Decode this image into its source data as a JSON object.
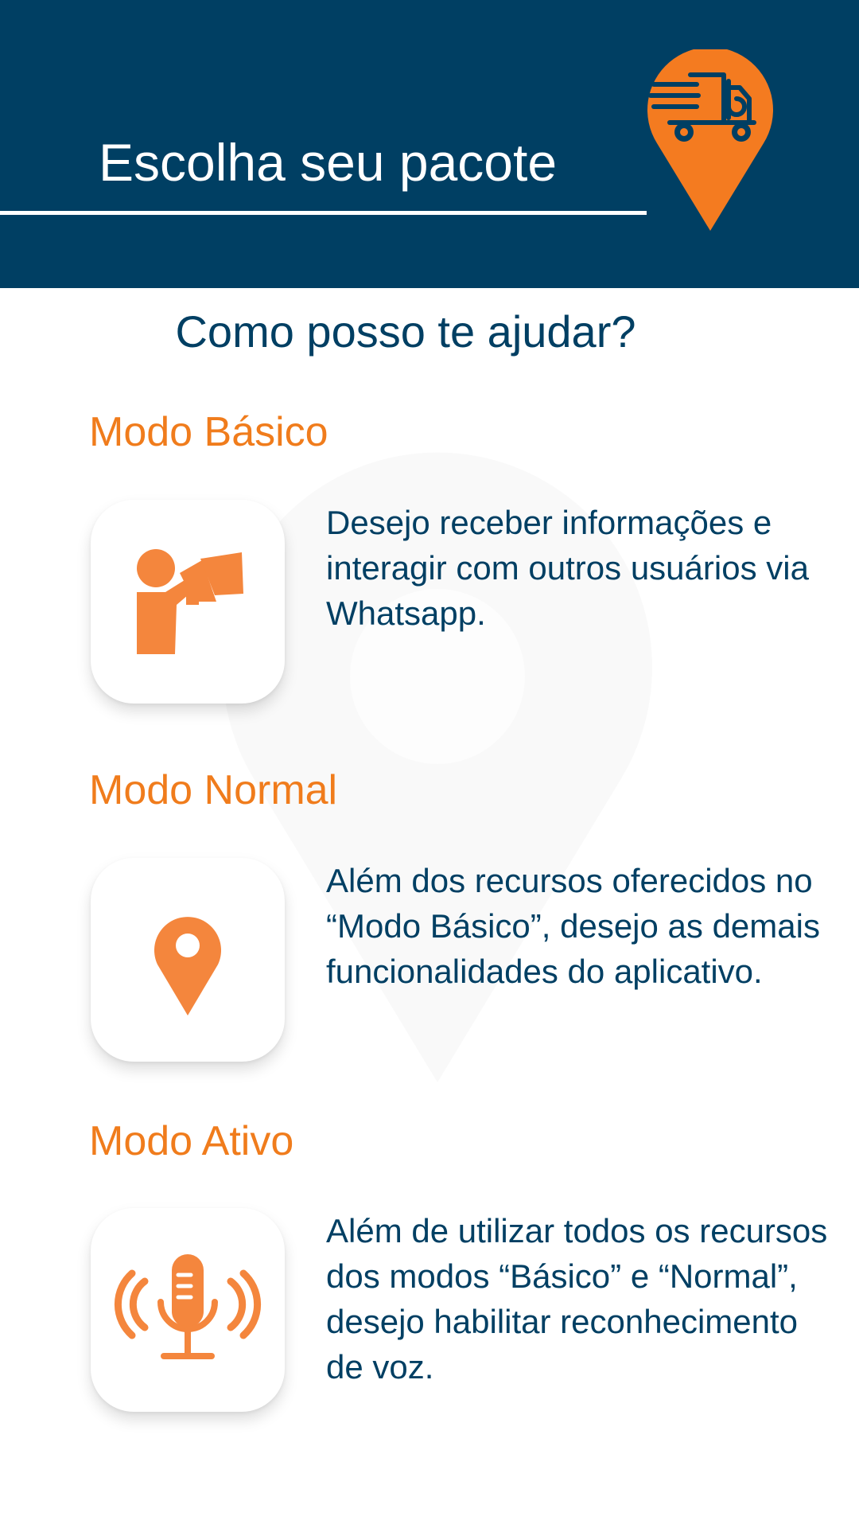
{
  "header": {
    "title": "Escolha seu pacote",
    "logo_icon": "delivery-truck-location-pin-icon"
  },
  "subtitle": "Como posso te ajudar?",
  "modes": [
    {
      "title": "Modo Básico",
      "icon": "megaphone-person-icon",
      "description": "Desejo receber informações e interagir com outros usuários via Whatsapp."
    },
    {
      "title": "Modo Normal",
      "icon": "location-pin-icon",
      "description": "Além dos recursos oferecidos no “Modo Básico”, desejo as demais funcionalidades do aplicativo."
    },
    {
      "title": "Modo Ativo",
      "icon": "microphone-voice-icon",
      "description": "Além de utilizar todos os recursos dos modos “Básico” e “Normal”, desejo habilitar reconhecimento de voz."
    }
  ],
  "colors": {
    "header_bg": "#003f63",
    "accent_orange": "#f07c1c",
    "text_navy": "#003f63"
  }
}
